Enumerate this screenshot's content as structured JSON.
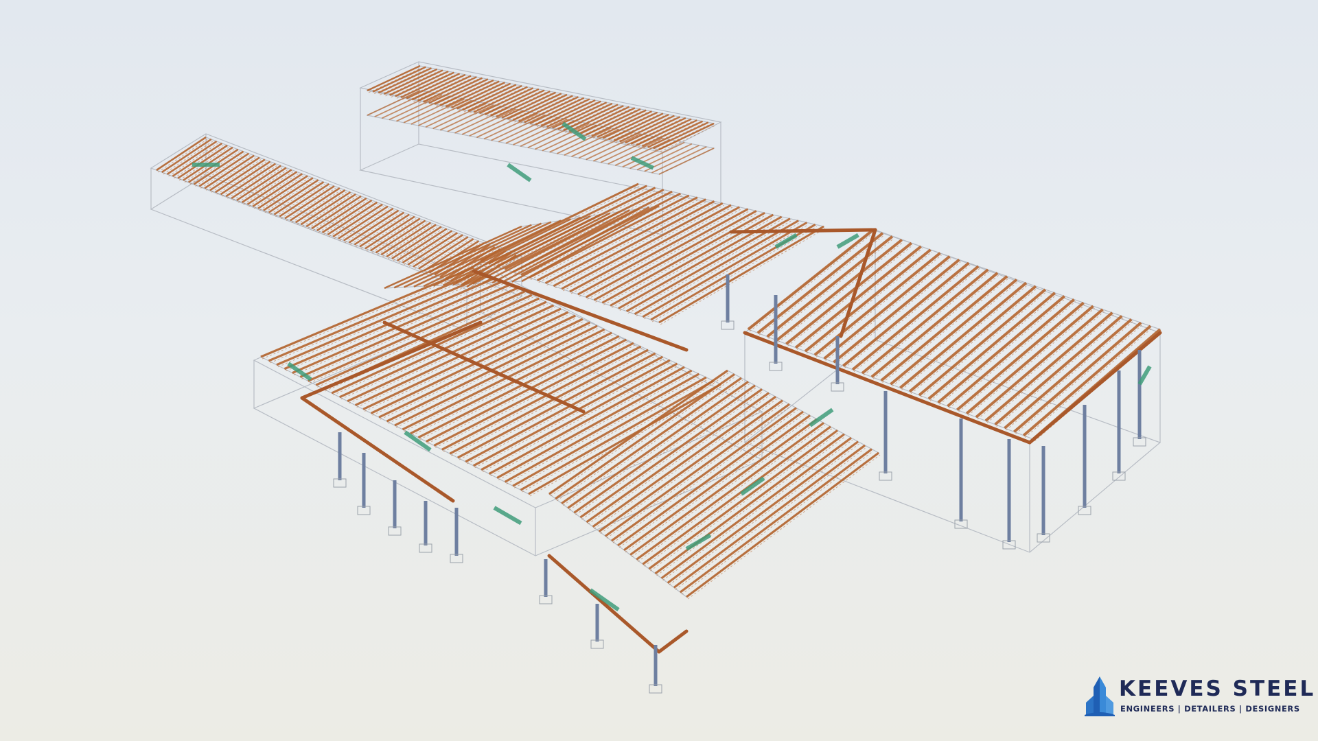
{
  "brand": {
    "name": "KEEVES STEEL",
    "tagline": "ENGINEERS | DETAILERS | DESIGNERS",
    "logo_icon": "building-tower-icon",
    "logo_colors": [
      "#1f5fb4",
      "#3a8ad8"
    ],
    "text_color": "#1f2a57"
  },
  "scene": {
    "description_icon": "3d-steel-structure-model",
    "background_top": "#e2e8ef",
    "background_bottom": "#ecece5",
    "joist_color": "#b5652f",
    "beam_color": "#a9582a",
    "column_color": "#6e7fa0",
    "wall_outline_color": "#b7bcc4",
    "bracing_color": "#3f9c7a"
  }
}
